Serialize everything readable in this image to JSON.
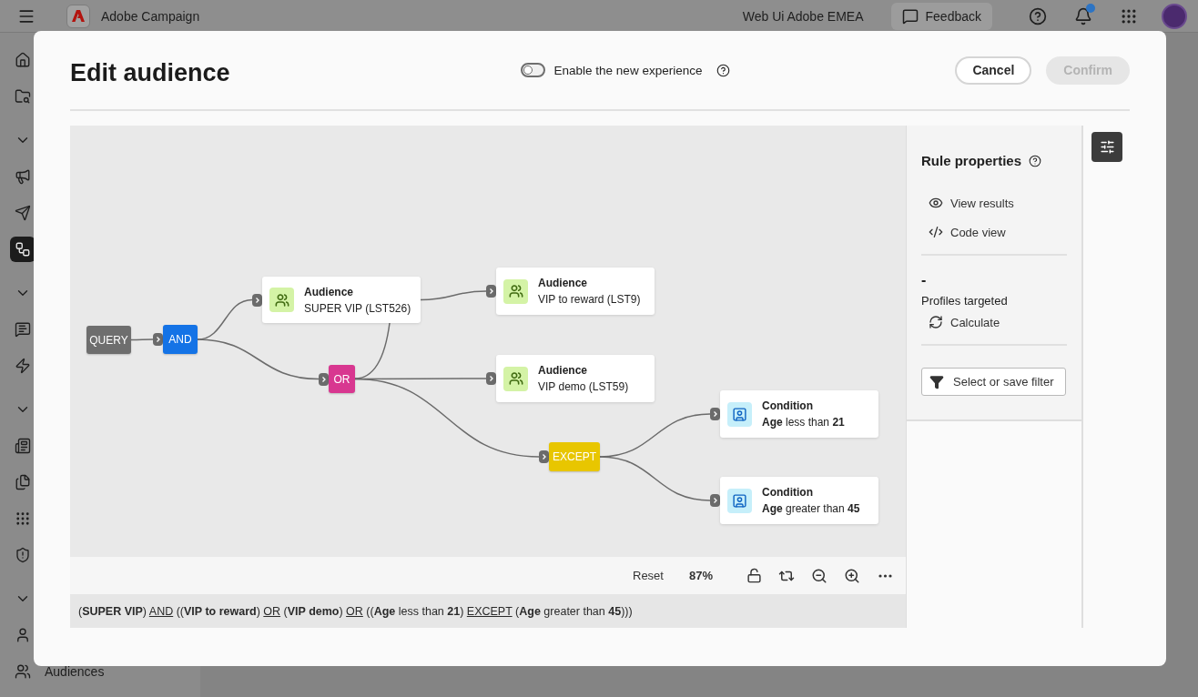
{
  "app_bar": {
    "product": "Adobe Campaign",
    "org": "Web Ui Adobe EMEA",
    "feedback": "Feedback",
    "has_notifications": true
  },
  "sidebar": {
    "items": [
      {
        "kind": "home",
        "selected": false
      },
      {
        "kind": "folder-search",
        "selected": false
      },
      {
        "kind": "expand",
        "selected": false
      },
      {
        "kind": "megaphone",
        "selected": false
      },
      {
        "kind": "send",
        "selected": false
      },
      {
        "kind": "workflow",
        "selected": true
      },
      {
        "kind": "expand",
        "selected": false
      },
      {
        "kind": "chat",
        "selected": false
      },
      {
        "kind": "bolt",
        "selected": false
      },
      {
        "kind": "expand",
        "selected": false
      },
      {
        "kind": "list",
        "selected": false
      },
      {
        "kind": "files",
        "selected": false
      },
      {
        "kind": "dots",
        "selected": false
      },
      {
        "kind": "shield",
        "selected": false
      },
      {
        "kind": "expand",
        "selected": false
      },
      {
        "kind": "person",
        "selected": false
      },
      {
        "kind": "people",
        "selected": false,
        "label": "Audiences"
      }
    ]
  },
  "dialog": {
    "title": "Edit audience",
    "toggle": {
      "label": "Enable the new experience",
      "on": false
    },
    "buttons": [
      {
        "label": "Cancel",
        "disabled": false
      },
      {
        "label": "Confirm",
        "disabled": true
      }
    ]
  },
  "canvas": {
    "nodes": [
      {
        "kind": "operator",
        "label": "QUERY",
        "color": "#6e6e6e"
      },
      {
        "kind": "operator",
        "label": "AND",
        "color": "#1473e6"
      },
      {
        "kind": "audience",
        "title": "Audience",
        "subtitle": "SUPER VIP (LST526)"
      },
      {
        "kind": "audience",
        "title": "Audience",
        "subtitle": "VIP to reward (LST9)"
      },
      {
        "kind": "operator",
        "label": "OR",
        "color": "#d83790"
      },
      {
        "kind": "audience",
        "title": "Audience",
        "subtitle": "VIP demo (LST59)"
      },
      {
        "kind": "operator",
        "label": "EXCEPT",
        "color": "#e8c600"
      },
      {
        "kind": "condition",
        "title": "Condition",
        "subtitle": "**Age** less than **21**"
      },
      {
        "kind": "condition",
        "title": "Condition",
        "subtitle": "**Age** greater than **45**"
      }
    ],
    "toolbar": {
      "reset": "Reset",
      "zoom": "87%"
    },
    "expression": [
      {
        "kind": "text",
        "text": "(**SUPER VIP**) "
      },
      {
        "kind": "operator",
        "text": "AND"
      },
      {
        "kind": "text",
        "text": " ((**VIP to reward**) "
      },
      {
        "kind": "operator",
        "text": "OR"
      },
      {
        "kind": "text",
        "text": " (**VIP demo**) "
      },
      {
        "kind": "operator",
        "text": "OR"
      },
      {
        "kind": "text",
        "text": " ((**Age** less than **21**) "
      },
      {
        "kind": "operator",
        "text": "EXCEPT"
      },
      {
        "kind": "text",
        "text": " (**Age** greater than **45**)))"
      }
    ]
  },
  "rule_panel": {
    "title": "Rule properties",
    "actions": [
      {
        "kind": "view",
        "label": "View results"
      },
      {
        "kind": "code",
        "label": "Code view"
      }
    ],
    "count": "-",
    "count_label": "Profiles targeted",
    "calculate": "Calculate",
    "filter_button": "Select or save filter"
  }
}
